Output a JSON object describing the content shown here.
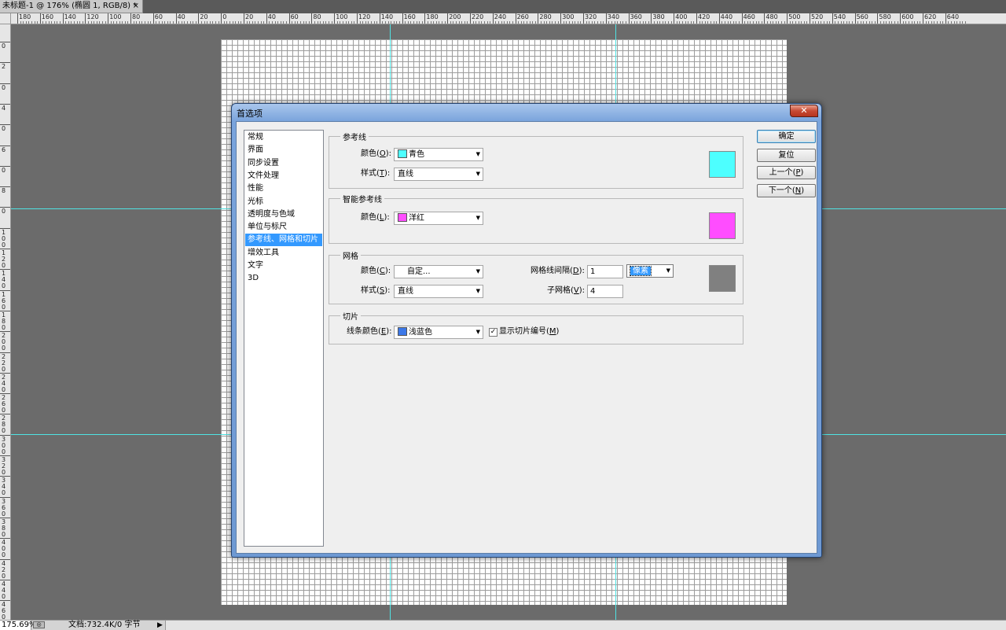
{
  "document": {
    "tab_title": "未标题-1 @ 176% (椭圆 1, RGB/8) *",
    "close_glyph": "×"
  },
  "hruler_labels": [
    "180",
    "160",
    "140",
    "120",
    "100",
    "80",
    "60",
    "40",
    "20",
    "0",
    "20",
    "40",
    "60",
    "80",
    "100",
    "120",
    "140",
    "160",
    "180",
    "200",
    "220",
    "240",
    "260",
    "280",
    "300",
    "320",
    "340",
    "360",
    "380",
    "400",
    "420",
    "440",
    "460",
    "480",
    "500",
    "520",
    "540",
    "560",
    "580",
    "600",
    "620",
    "640"
  ],
  "vruler_labels": [
    "0",
    "2",
    "0",
    "4",
    "0",
    "6",
    "0",
    "8",
    "0",
    "100",
    "120",
    "140",
    "160",
    "180",
    "200",
    "220",
    "240",
    "260",
    "280",
    "300",
    "320",
    "340",
    "360",
    "380",
    "400",
    "420",
    "440",
    "460",
    "480"
  ],
  "status": {
    "zoom": "175.69%",
    "doc_info": "文档:732.4K/0 字节",
    "arrow": "▶"
  },
  "dialog": {
    "title": "首选项",
    "close": "✕",
    "categories": [
      "常规",
      "界面",
      "同步设置",
      "文件处理",
      "性能",
      "光标",
      "透明度与色域",
      "单位与标尺",
      "参考线、网格和切片",
      "增效工具",
      "文字",
      "3D"
    ],
    "selected_index": 8,
    "buttons": {
      "ok": "确定",
      "reset": "复位",
      "prev_label": "上一个(",
      "prev_key": "P",
      "next_label": "下一个(",
      "next_key": "N"
    },
    "guides": {
      "group_title": "参考线",
      "color_label": "颜色(",
      "color_key": "O",
      "color_value": "青色",
      "color_hex": "#4dffff",
      "style_label": "样式(",
      "style_key": "T",
      "style_value": "直线"
    },
    "smart_guides": {
      "group_title": "智能参考线",
      "color_label": "颜色(",
      "color_key": "L",
      "color_value": "洋红",
      "color_hex": "#ff4dff"
    },
    "grid": {
      "group_title": "网格",
      "color_label": "颜色(",
      "color_key": "C",
      "color_value": "自定...",
      "color_hex": "#808080",
      "style_label": "样式(",
      "style_key": "S",
      "style_value": "直线",
      "interval_label": "网格线间隔(",
      "interval_key": "D",
      "interval_value": "1",
      "interval_unit": "像素",
      "subdiv_label": "子网格(",
      "subdiv_key": "V",
      "subdiv_value": "4"
    },
    "slices": {
      "group_title": "切片",
      "line_color_label": "线条颜色(",
      "line_color_key": "E",
      "line_color_value": "浅蓝色",
      "line_color_hex": "#3c78e8",
      "show_numbers_label": "显示切片编号(",
      "show_numbers_key": "M",
      "show_numbers_checked": "✓"
    }
  }
}
